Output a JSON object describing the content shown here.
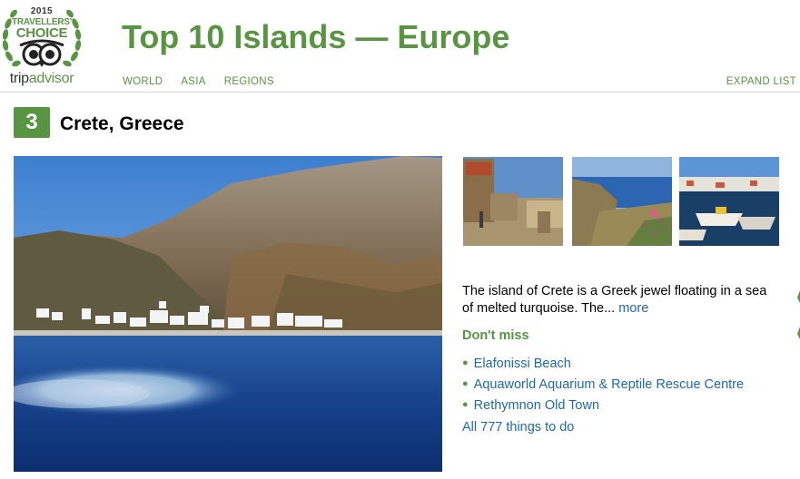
{
  "logo": {
    "year": "2015",
    "tc_line1": "TRAVELLERS'",
    "tc_line2": "CHOICE",
    "brand_trip": "trip",
    "brand_advisor": "advisor"
  },
  "header": {
    "title": "Top 10 Islands — Europe",
    "nav": [
      "WORLD",
      "ASIA",
      "REGIONS"
    ],
    "expand_label": "EXPAND LIST"
  },
  "destination": {
    "rank": "3",
    "name": "Crete, Greece",
    "description": "The island of Crete is a Greek jewel floating in a sea of melted turquoise. The...",
    "more_label": "more",
    "dont_miss_label": "Don't miss",
    "attractions": [
      "Elafonissi Beach",
      "Aquaworld Aquarium & Reptile Rescue Centre",
      "Rethymnon Old Town"
    ],
    "all_things_label": "All 777 things to do"
  },
  "colors": {
    "brand_green": "#589442",
    "link_blue": "#1f6aa5",
    "rule_gray": "#d8d8d8"
  },
  "icons": {
    "owl": "owl-eyes-icon",
    "laurel": "laurel-wreath-icon"
  }
}
